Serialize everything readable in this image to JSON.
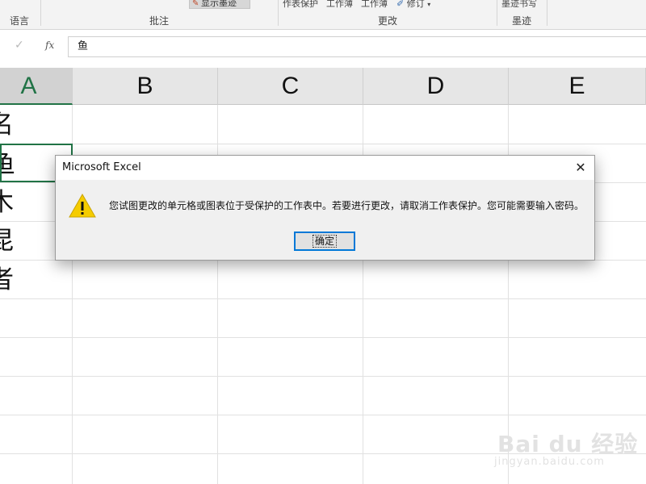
{
  "ribbon": {
    "show_ink_label": "显示墨迹",
    "protect_items": [
      "作表保护",
      "工作薄",
      "工作薄",
      "修订"
    ],
    "ink_label": "墨迹书写",
    "groups": {
      "language": "语言",
      "comments": "批注",
      "changes": "更改",
      "ink": "墨迹"
    }
  },
  "formula_bar": {
    "fx_label": "fx",
    "value": "鱼"
  },
  "grid": {
    "columns": [
      "A",
      "B",
      "C",
      "D",
      "E"
    ],
    "selected_column": "A",
    "cells_a": [
      "名",
      "鱼",
      "木",
      "昆",
      "者"
    ]
  },
  "dialog": {
    "title": "Microsoft Excel",
    "close_symbol": "✕",
    "icon": "warning-icon",
    "message": "您试图更改的单元格或图表位于受保护的工作表中。若要进行更改，请取消工作表保护。您可能需要输入密码。",
    "ok_label": "确定"
  },
  "watermark": {
    "brand": "Bai du 经验",
    "url": "jingyan.baidu.com"
  },
  "colors": {
    "excel_green": "#217346",
    "warning_yellow": "#f5cc00",
    "focus_blue": "#0078d7"
  }
}
